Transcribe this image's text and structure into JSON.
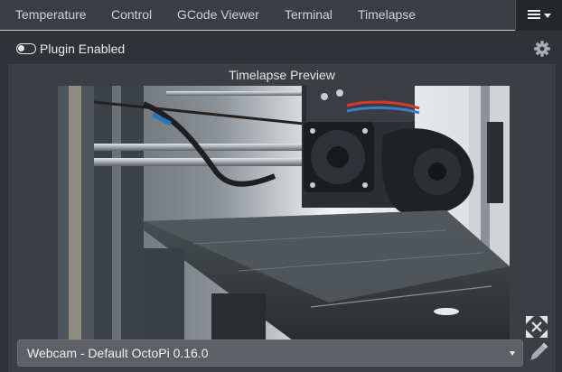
{
  "tabs": [
    {
      "label": "Temperature"
    },
    {
      "label": "Control"
    },
    {
      "label": "GCode Viewer"
    },
    {
      "label": "Terminal"
    },
    {
      "label": "Timelapse"
    }
  ],
  "menu": {
    "icon": "hamburger-menu-icon"
  },
  "plugin_toggle": {
    "label": "Plugin Enabled",
    "enabled": true
  },
  "settings": {
    "icon": "gear-icon"
  },
  "preview": {
    "title": "Timelapse Preview",
    "image": "webcam-printer-image",
    "fullscreen_icon": "fullscreen-icon",
    "edit_icon": "pencil-icon"
  },
  "webcam_select": {
    "value": "Webcam - Default OctoPi 0.16.0"
  },
  "colors": {
    "background": "#2f3236",
    "tabbar": "#3a3d41",
    "select": "#5d6166"
  }
}
